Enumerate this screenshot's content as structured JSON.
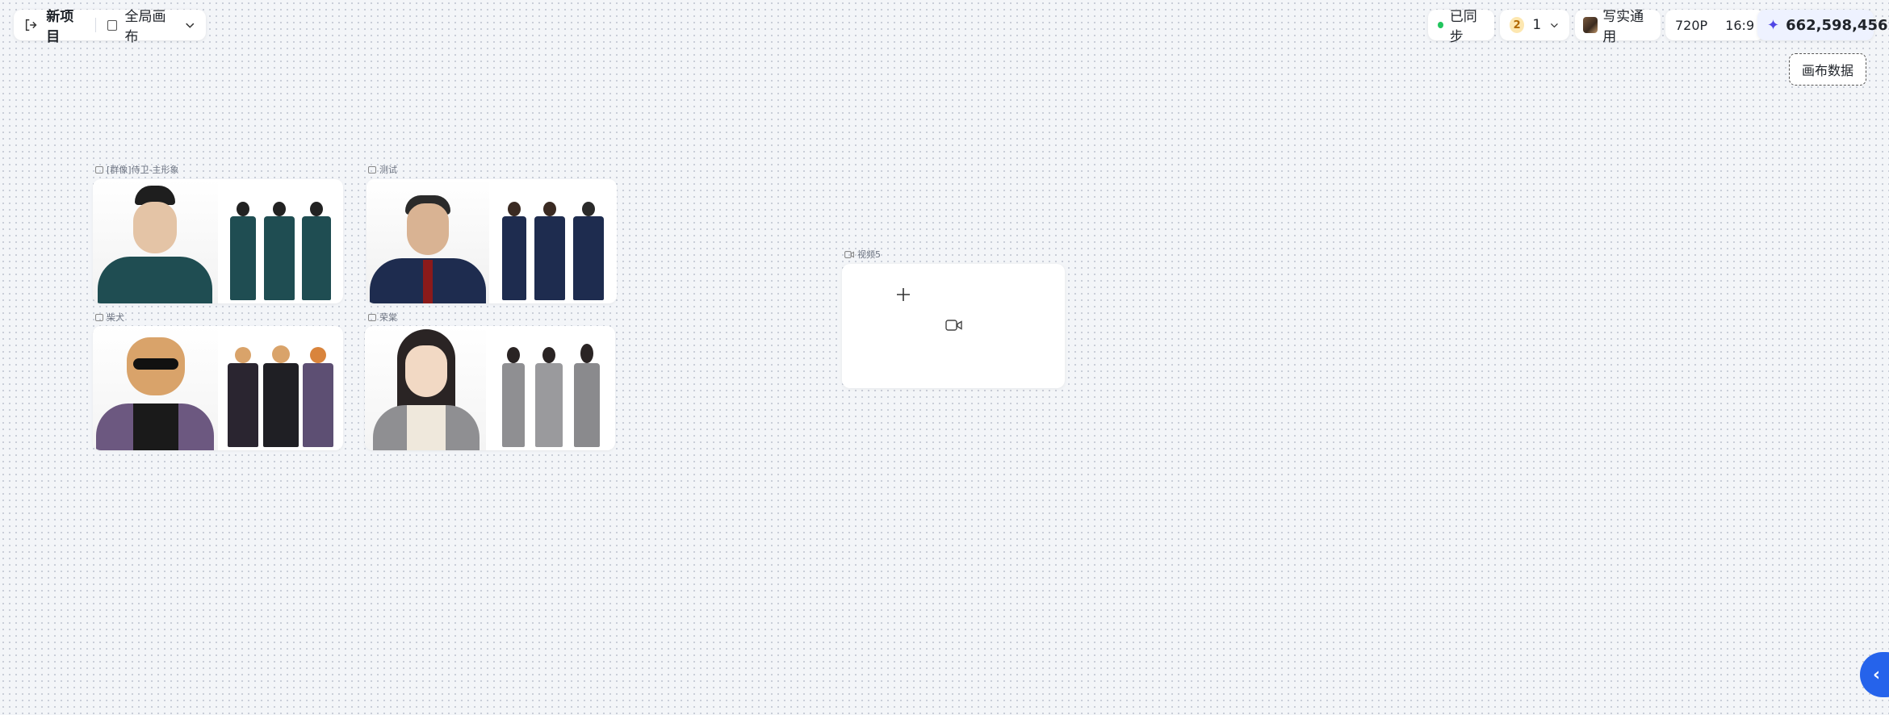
{
  "header": {
    "project_title": "新项目",
    "canvas_selector": "全局画布",
    "sync_status": "已同步",
    "count_badge": "2",
    "count_value": "1",
    "style_name": "写实通用",
    "resolution": "720P",
    "aspect_ratio": "16:9",
    "credits": "662,598,456",
    "canvas_data_button": "画布数据"
  },
  "nodes": [
    {
      "label": "[群像]侍卫-主形象"
    },
    {
      "label": "测试"
    },
    {
      "label": "柴犬"
    },
    {
      "label": "荣棠"
    }
  ],
  "video_node": {
    "label": "视频5"
  },
  "colors": {
    "accent": "#2563eb",
    "sync_dot": "#22c55e",
    "credit_bg": "#eef2ff",
    "credit_icon": "#4f46e5"
  },
  "icons": {
    "exit": "exit-icon",
    "canvas": "canvas-square-icon",
    "dropdown": "chevron-down-icon",
    "plus": "plus-icon",
    "video": "video-camera-icon",
    "collapse": "chevron-left-icon"
  }
}
